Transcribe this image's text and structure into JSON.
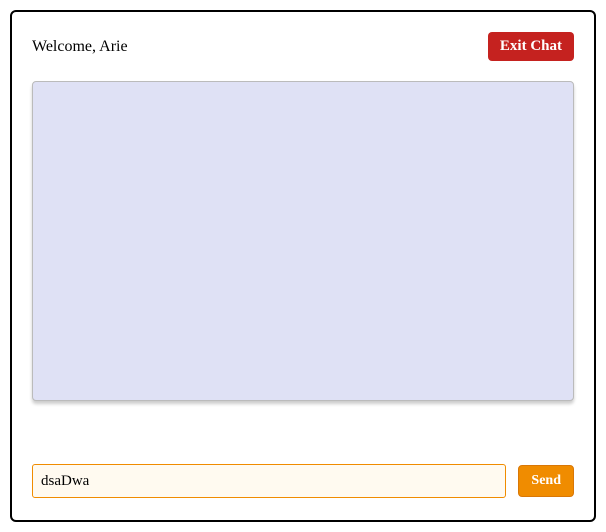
{
  "header": {
    "welcome_text": "Welcome, Arie",
    "exit_label": "Exit Chat"
  },
  "input": {
    "value": "dsaDwa",
    "send_label": "Send"
  }
}
